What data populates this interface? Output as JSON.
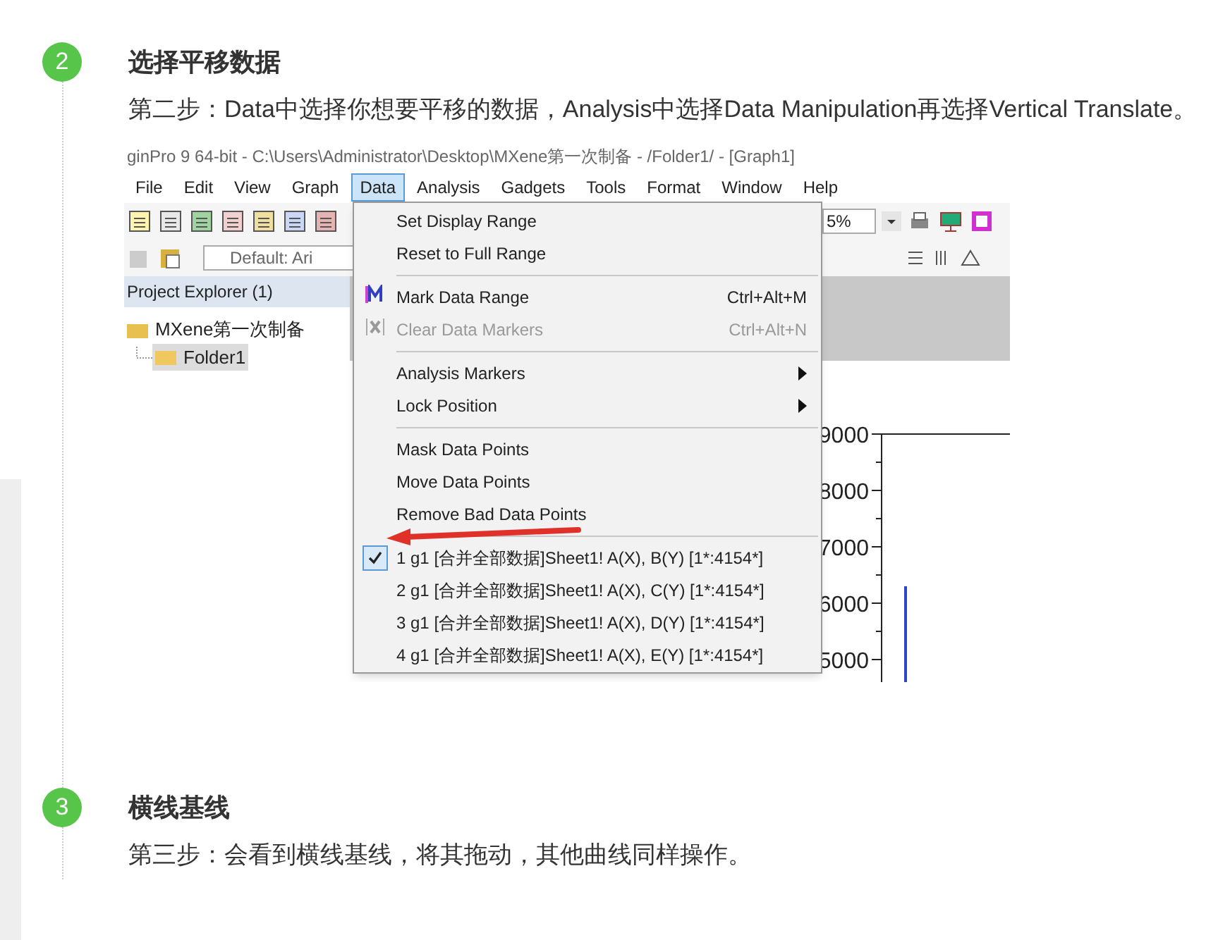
{
  "steps": [
    {
      "number": "2",
      "title": "选择平移数据",
      "text": "第二步：Data中选择你想要平移的数据，Analysis中选择Data Manipulation再选择Vertical Translate。",
      "screenshot": {
        "title": "ginPro 9 64-bit - C:\\Users\\Administrator\\Desktop\\MXene第一次制备 - /Folder1/ - [Graph1]",
        "menu_bar": [
          {
            "label": "File",
            "selected": false
          },
          {
            "label": "Edit",
            "selected": false
          },
          {
            "label": "View",
            "selected": false
          },
          {
            "label": "Graph",
            "selected": false
          },
          {
            "label": "Data",
            "selected": true
          },
          {
            "label": "Analysis",
            "selected": false
          },
          {
            "label": "Gadgets",
            "selected": false
          },
          {
            "label": "Tools",
            "selected": false
          },
          {
            "label": "Format",
            "selected": false
          },
          {
            "label": "Window",
            "selected": false
          },
          {
            "label": "Help",
            "selected": false
          }
        ],
        "zoom": "5%",
        "font_box": "Default: Ari",
        "project_explorer": {
          "title": "Project Explorer (1)",
          "tree": [
            {
              "label": "MXene第一次制备",
              "children": [
                {
                  "label": "Folder1",
                  "selected": true
                }
              ]
            }
          ]
        },
        "menu": [
          {
            "kind": "item",
            "label": "Set Display Range",
            "disabled": false
          },
          {
            "kind": "item",
            "label": "Reset to Full Range",
            "disabled": false
          },
          {
            "kind": "separator"
          },
          {
            "kind": "mark",
            "label": "Mark Data Range",
            "shortcut": "Ctrl+Alt+M",
            "disabled": false
          },
          {
            "kind": "clear",
            "label": "Clear Data Markers",
            "shortcut": "Ctrl+Alt+N",
            "disabled": true
          },
          {
            "kind": "separator"
          },
          {
            "kind": "submenu",
            "label": "Analysis Markers",
            "disabled": false
          },
          {
            "kind": "submenu",
            "label": "Lock Position",
            "disabled": false
          },
          {
            "kind": "separator"
          },
          {
            "kind": "item",
            "label": "Mask Data Points",
            "disabled": false
          },
          {
            "kind": "item",
            "label": "Move Data Points",
            "disabled": false
          },
          {
            "kind": "item",
            "label": "Remove Bad Data Points",
            "disabled": false
          },
          {
            "kind": "separator"
          },
          {
            "kind": "check",
            "label": "1 g1 [合并全部数据]Sheet1! A(X), B(Y) [1*:4154*]",
            "checked": true
          },
          {
            "kind": "check",
            "label": "2 g1 [合并全部数据]Sheet1! A(X), C(Y) [1*:4154*]",
            "checked": false
          },
          {
            "kind": "check",
            "label": "3 g1 [合并全部数据]Sheet1! A(X), D(Y) [1*:4154*]",
            "checked": false
          },
          {
            "kind": "check",
            "label": "4 g1 [合并全部数据]Sheet1! A(X), E(Y) [1*:4154*]",
            "checked": false
          }
        ],
        "axis_labels": [
          "9000",
          "8000",
          "7000",
          "6000",
          "5000"
        ]
      }
    },
    {
      "number": "3",
      "title": "横线基线",
      "text": "第三步：会看到横线基线，将其拖动，其他曲线同样操作。"
    }
  ]
}
